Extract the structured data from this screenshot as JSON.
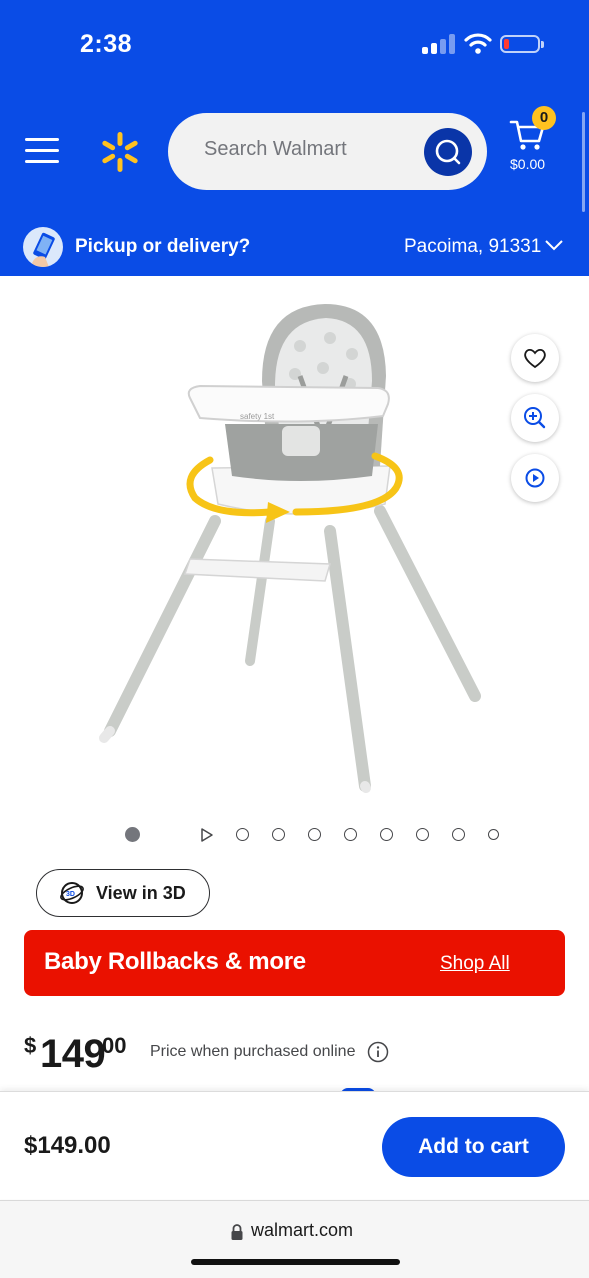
{
  "status_bar": {
    "time": "2:38",
    "battery_level": 0.15,
    "icons": [
      "cellular-signal-icon",
      "wifi-icon",
      "battery-icon"
    ]
  },
  "header": {
    "search_placeholder": "Search Walmart",
    "cart_count": "0",
    "cart_total": "$0.00",
    "brand_color": "#0a4ce6",
    "accent_color": "#ffc220",
    "icons": [
      "menu-icon",
      "walmart-spark-icon",
      "search-icon",
      "cart-icon"
    ]
  },
  "pickup": {
    "label": "Pickup or delivery?",
    "location": "Pacoima, 91331"
  },
  "product_image": {
    "icons": [
      "heart-icon",
      "zoom-in-icon",
      "play-icon"
    ],
    "carousel": {
      "total": 10,
      "active_index": 0,
      "video_index": 1
    }
  },
  "view3d": {
    "label": "View in 3D"
  },
  "banner": {
    "title": "Baby Rollbacks & more",
    "link": "Shop All",
    "color": "#ea1100"
  },
  "price": {
    "currency": "$",
    "dollars": "149",
    "cents": "00",
    "note": "Price when purchased online"
  },
  "bottom_bar": {
    "price": "$149.00",
    "add_to_cart": "Add to cart"
  },
  "browser": {
    "url": "walmart.com"
  }
}
